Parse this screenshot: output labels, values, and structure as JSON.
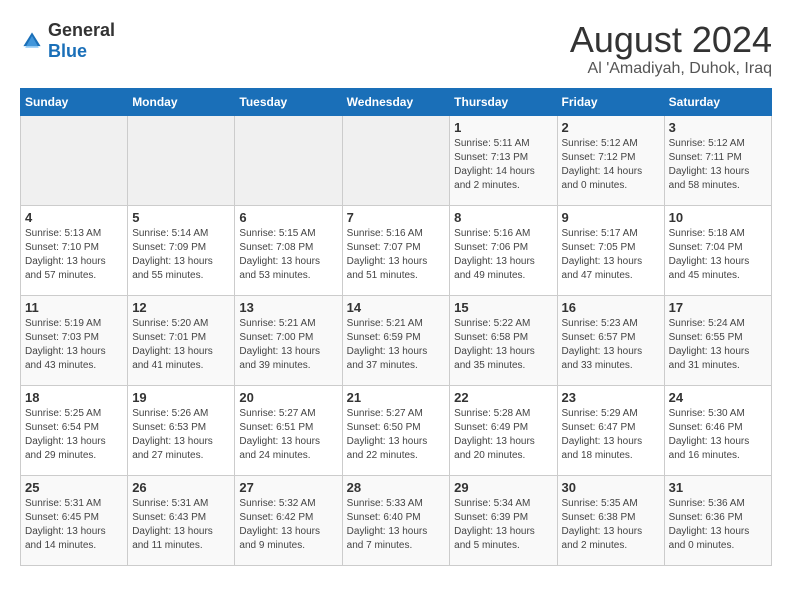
{
  "logo": {
    "general": "General",
    "blue": "Blue"
  },
  "header": {
    "title": "August 2024",
    "subtitle": "Al 'Amadiyah, Duhok, Iraq"
  },
  "columns": [
    "Sunday",
    "Monday",
    "Tuesday",
    "Wednesday",
    "Thursday",
    "Friday",
    "Saturday"
  ],
  "weeks": [
    [
      {
        "day": "",
        "empty": true
      },
      {
        "day": "",
        "empty": true
      },
      {
        "day": "",
        "empty": true
      },
      {
        "day": "",
        "empty": true
      },
      {
        "day": "1",
        "sunrise": "5:11 AM",
        "sunset": "7:13 PM",
        "daylight": "14 hours and 2 minutes."
      },
      {
        "day": "2",
        "sunrise": "5:12 AM",
        "sunset": "7:12 PM",
        "daylight": "14 hours and 0 minutes."
      },
      {
        "day": "3",
        "sunrise": "5:12 AM",
        "sunset": "7:11 PM",
        "daylight": "13 hours and 58 minutes."
      }
    ],
    [
      {
        "day": "4",
        "sunrise": "5:13 AM",
        "sunset": "7:10 PM",
        "daylight": "13 hours and 57 minutes."
      },
      {
        "day": "5",
        "sunrise": "5:14 AM",
        "sunset": "7:09 PM",
        "daylight": "13 hours and 55 minutes."
      },
      {
        "day": "6",
        "sunrise": "5:15 AM",
        "sunset": "7:08 PM",
        "daylight": "13 hours and 53 minutes."
      },
      {
        "day": "7",
        "sunrise": "5:16 AM",
        "sunset": "7:07 PM",
        "daylight": "13 hours and 51 minutes."
      },
      {
        "day": "8",
        "sunrise": "5:16 AM",
        "sunset": "7:06 PM",
        "daylight": "13 hours and 49 minutes."
      },
      {
        "day": "9",
        "sunrise": "5:17 AM",
        "sunset": "7:05 PM",
        "daylight": "13 hours and 47 minutes."
      },
      {
        "day": "10",
        "sunrise": "5:18 AM",
        "sunset": "7:04 PM",
        "daylight": "13 hours and 45 minutes."
      }
    ],
    [
      {
        "day": "11",
        "sunrise": "5:19 AM",
        "sunset": "7:03 PM",
        "daylight": "13 hours and 43 minutes."
      },
      {
        "day": "12",
        "sunrise": "5:20 AM",
        "sunset": "7:01 PM",
        "daylight": "13 hours and 41 minutes."
      },
      {
        "day": "13",
        "sunrise": "5:21 AM",
        "sunset": "7:00 PM",
        "daylight": "13 hours and 39 minutes."
      },
      {
        "day": "14",
        "sunrise": "5:21 AM",
        "sunset": "6:59 PM",
        "daylight": "13 hours and 37 minutes."
      },
      {
        "day": "15",
        "sunrise": "5:22 AM",
        "sunset": "6:58 PM",
        "daylight": "13 hours and 35 minutes."
      },
      {
        "day": "16",
        "sunrise": "5:23 AM",
        "sunset": "6:57 PM",
        "daylight": "13 hours and 33 minutes."
      },
      {
        "day": "17",
        "sunrise": "5:24 AM",
        "sunset": "6:55 PM",
        "daylight": "13 hours and 31 minutes."
      }
    ],
    [
      {
        "day": "18",
        "sunrise": "5:25 AM",
        "sunset": "6:54 PM",
        "daylight": "13 hours and 29 minutes."
      },
      {
        "day": "19",
        "sunrise": "5:26 AM",
        "sunset": "6:53 PM",
        "daylight": "13 hours and 27 minutes."
      },
      {
        "day": "20",
        "sunrise": "5:27 AM",
        "sunset": "6:51 PM",
        "daylight": "13 hours and 24 minutes."
      },
      {
        "day": "21",
        "sunrise": "5:27 AM",
        "sunset": "6:50 PM",
        "daylight": "13 hours and 22 minutes."
      },
      {
        "day": "22",
        "sunrise": "5:28 AM",
        "sunset": "6:49 PM",
        "daylight": "13 hours and 20 minutes."
      },
      {
        "day": "23",
        "sunrise": "5:29 AM",
        "sunset": "6:47 PM",
        "daylight": "13 hours and 18 minutes."
      },
      {
        "day": "24",
        "sunrise": "5:30 AM",
        "sunset": "6:46 PM",
        "daylight": "13 hours and 16 minutes."
      }
    ],
    [
      {
        "day": "25",
        "sunrise": "5:31 AM",
        "sunset": "6:45 PM",
        "daylight": "13 hours and 14 minutes."
      },
      {
        "day": "26",
        "sunrise": "5:31 AM",
        "sunset": "6:43 PM",
        "daylight": "13 hours and 11 minutes."
      },
      {
        "day": "27",
        "sunrise": "5:32 AM",
        "sunset": "6:42 PM",
        "daylight": "13 hours and 9 minutes."
      },
      {
        "day": "28",
        "sunrise": "5:33 AM",
        "sunset": "6:40 PM",
        "daylight": "13 hours and 7 minutes."
      },
      {
        "day": "29",
        "sunrise": "5:34 AM",
        "sunset": "6:39 PM",
        "daylight": "13 hours and 5 minutes."
      },
      {
        "day": "30",
        "sunrise": "5:35 AM",
        "sunset": "6:38 PM",
        "daylight": "13 hours and 2 minutes."
      },
      {
        "day": "31",
        "sunrise": "5:36 AM",
        "sunset": "6:36 PM",
        "daylight": "13 hours and 0 minutes."
      }
    ]
  ],
  "labels": {
    "sunrise": "Sunrise: ",
    "sunset": "Sunset: ",
    "daylight": "Daylight hours"
  }
}
